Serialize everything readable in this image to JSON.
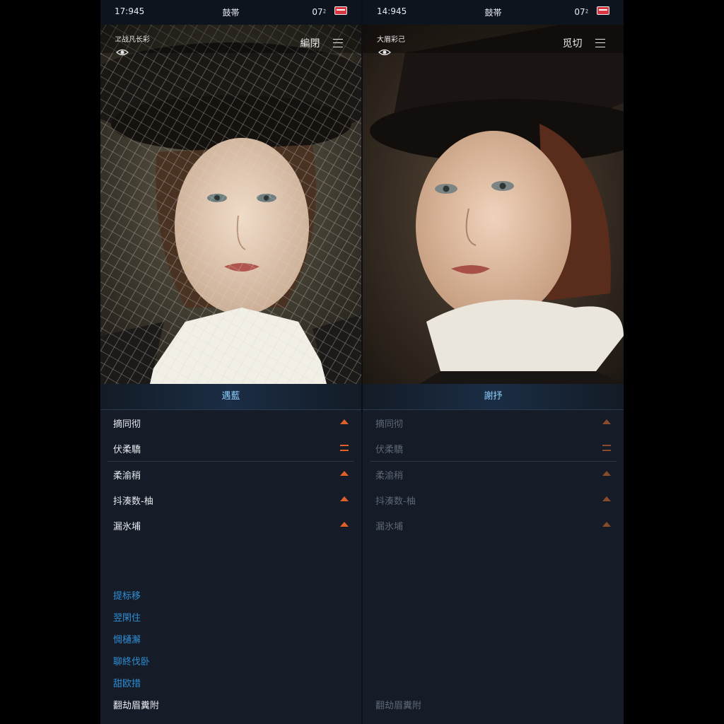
{
  "panels": [
    {
      "status": {
        "time": "17:945",
        "carrier": "鼓帯",
        "battery": "07⁲"
      },
      "caption": "ヱ战凡长彩",
      "top_action": "編閉",
      "section_title": "遇藍",
      "menu": [
        "摘同彻",
        "伏柔驕",
        "柔渝稍",
        "抖湊数-柚",
        "漏氷埔"
      ],
      "links": [
        "提标移",
        "翌閑住",
        "惆樋澥",
        "聊終伐卧",
        "甜欧措"
      ],
      "footer": "翻劫眉糞附"
    },
    {
      "status": {
        "time": "14:945",
        "carrier": "鼓帯",
        "battery": "07⁲"
      },
      "caption": "大眉彩己",
      "top_action": "觅切",
      "section_title": "謝抒",
      "menu": [
        "摘同彻",
        "伏柔驕",
        "柔渝稍",
        "抖湊数-柚",
        "漏氷埔"
      ],
      "links": [],
      "footer": "翻劫眉糞附"
    }
  ],
  "colors": {
    "accent_link": "#2f8fd6",
    "arrow": "#e0602a",
    "header_text": "#8fd0ff"
  },
  "icons": [
    "eye-icon",
    "menu-icon",
    "battery-icon",
    "up-arrow-icon",
    "lines-icon"
  ]
}
